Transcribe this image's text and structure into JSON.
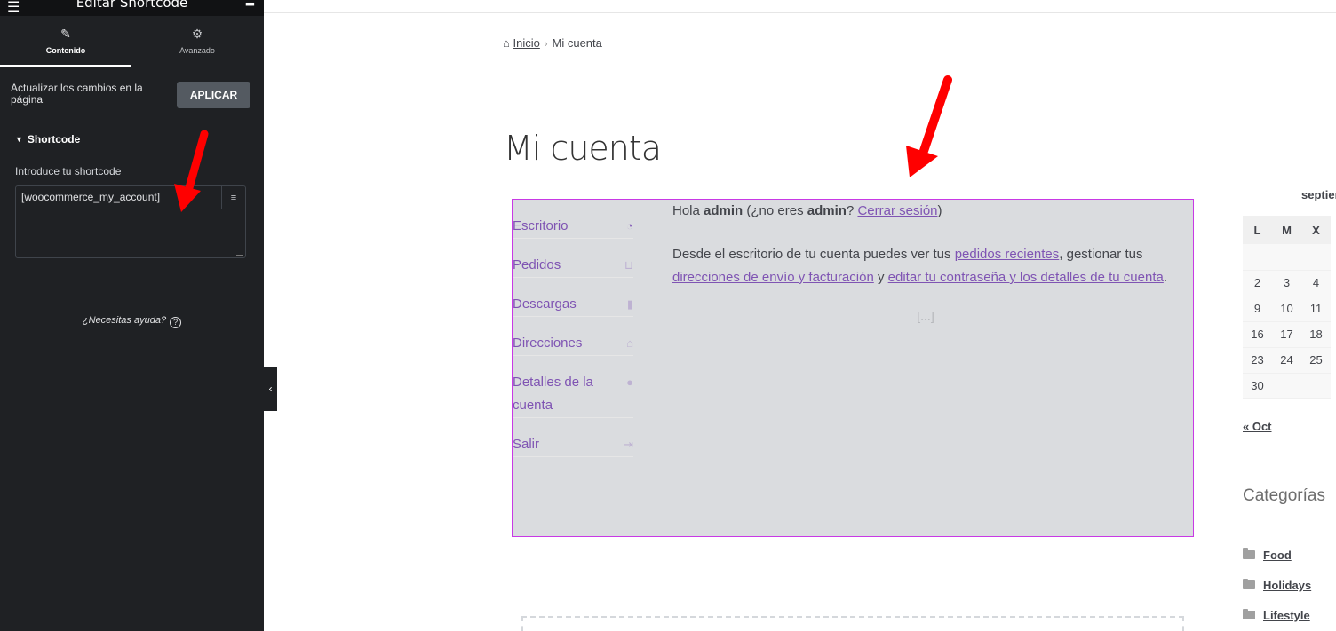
{
  "editor": {
    "title": "Editar Shortcode",
    "tabs": [
      {
        "label": "Contenido",
        "icon": "pencil-icon"
      },
      {
        "label": "Avanzado",
        "icon": "gear-icon"
      }
    ],
    "apply_text": "Actualizar los cambios en la página",
    "apply_button": "APLICAR",
    "section_title": "Shortcode",
    "field_label": "Introduce tu shortcode",
    "shortcode_value": "[woocommerce_my_account]",
    "help_text": "¿Necesitas ayuda?"
  },
  "breadcrumb": {
    "home": "Inicio",
    "current": "Mi cuenta"
  },
  "page_title": "Mi cuenta",
  "account_nav": [
    {
      "label": "Escritorio",
      "icon": "dashboard-icon"
    },
    {
      "label": "Pedidos",
      "icon": "basket-icon"
    },
    {
      "label": "Descargas",
      "icon": "file-icon"
    },
    {
      "label": "Direcciones",
      "icon": "home-icon"
    },
    {
      "label": "Detalles de la cuenta",
      "icon": "user-icon"
    },
    {
      "label": "Salir",
      "icon": "logout-icon"
    }
  ],
  "account_content": {
    "hello_prefix": "Hola",
    "user": "admin",
    "not_you_prefix": "(¿no eres",
    "user2": "admin",
    "q_mark": "?",
    "logout_link": "Cerrar sesión",
    "close_paren": ")",
    "dash_text_1": "Desde el escritorio de tu cuenta puedes ver tus",
    "link_orders": "pedidos recientes",
    "dash_text_2": ", gestionar tus",
    "link_addresses": "direcciones de envío y facturación",
    "dash_text_3": "y",
    "link_account": "editar tu contraseña y los detalles de tu cuenta",
    "dash_text_4": ".",
    "ellipsis": "[...]"
  },
  "calendar": {
    "month": "septiem",
    "headers": [
      "L",
      "M",
      "X"
    ],
    "rows": [
      [
        "",
        "",
        ""
      ],
      [
        "2",
        "3",
        "4"
      ],
      [
        "9",
        "10",
        "11"
      ],
      [
        "16",
        "17",
        "18"
      ],
      [
        "23",
        "24",
        "25"
      ],
      [
        "30",
        "",
        ""
      ]
    ],
    "prev": "« Oct"
  },
  "categories": {
    "title": "Categorías",
    "items": [
      "Food",
      "Holidays",
      "Lifestyle"
    ]
  },
  "colors": {
    "panel_bg": "#1f2124",
    "link_purple": "#7f54b3",
    "highlight_border": "#c839e5",
    "arrow_red": "#ff0000"
  }
}
